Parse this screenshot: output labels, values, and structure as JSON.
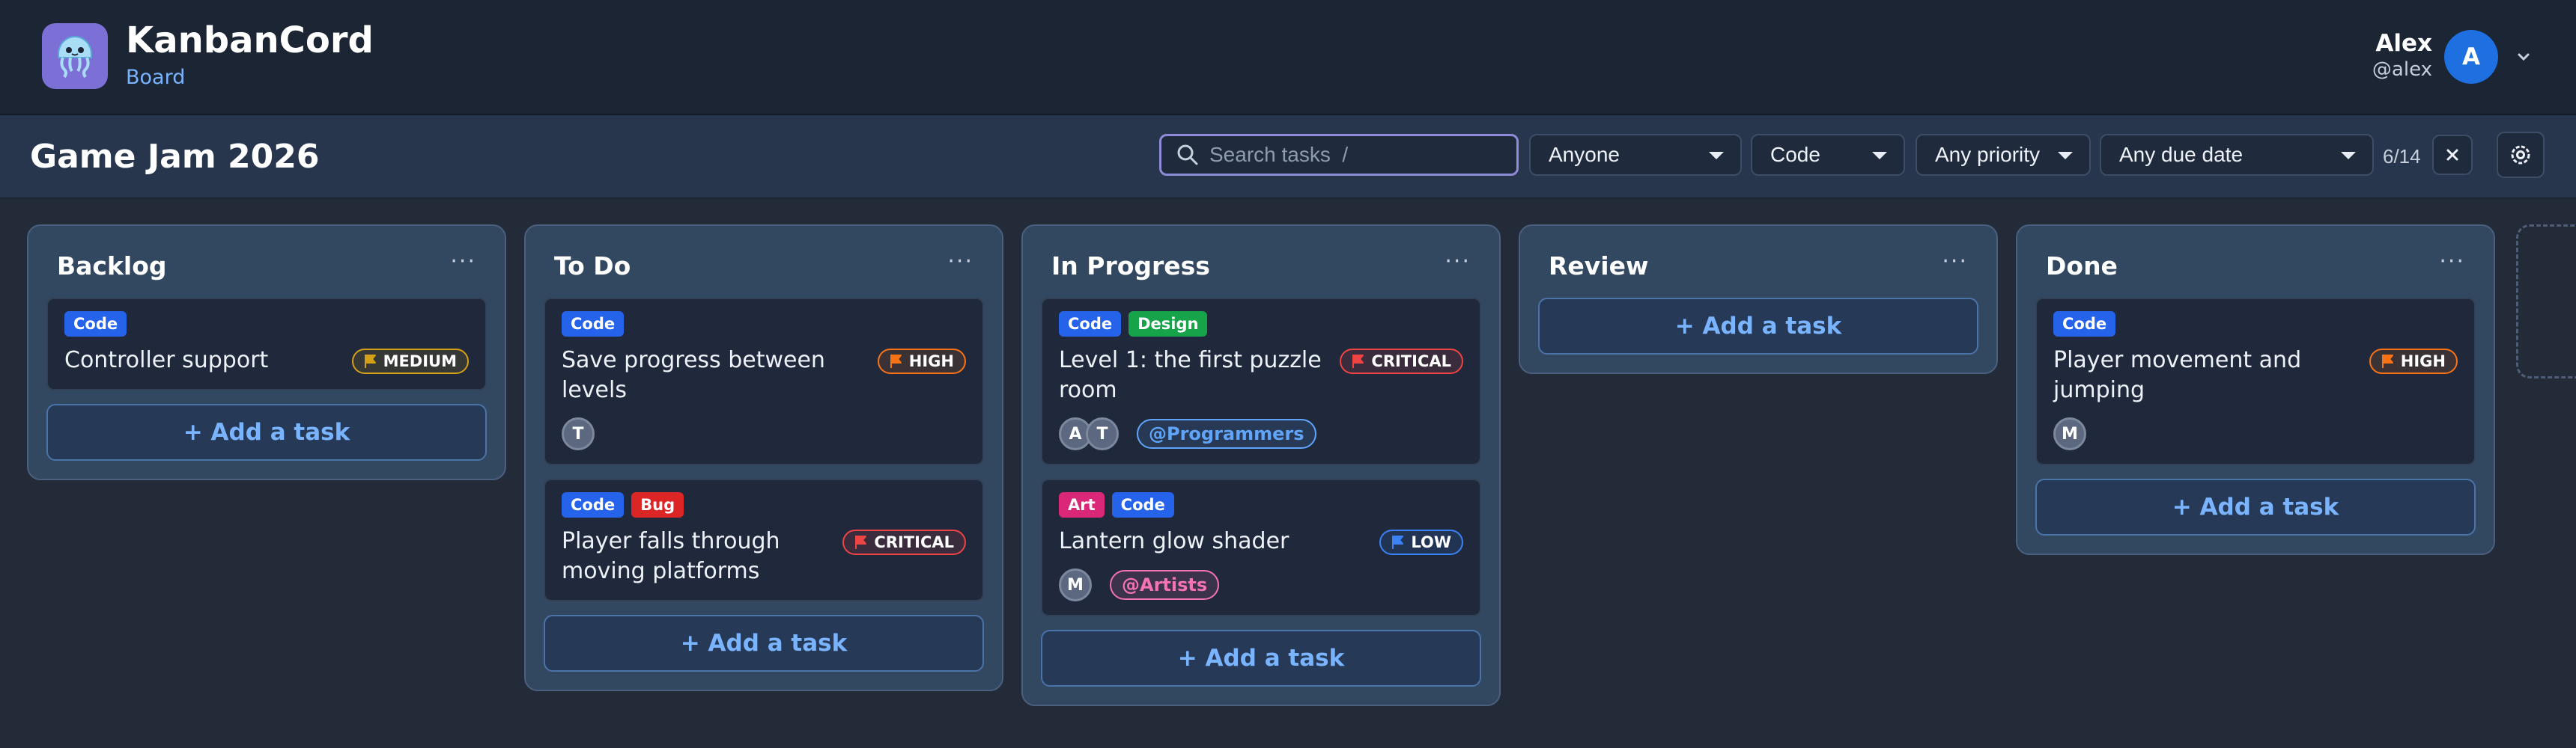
{
  "app": {
    "title": "KanbanCord",
    "subtitle": "Board"
  },
  "user": {
    "name": "Alex",
    "handle": "@alex",
    "avatar_initial": "A"
  },
  "board": {
    "title": "Game Jam 2026"
  },
  "filters": {
    "search_placeholder": "Search tasks  /",
    "assignee": "Anyone",
    "label": "Code",
    "priority": "Any priority",
    "due": "Any due date",
    "count": "6/14"
  },
  "colors": {
    "Code": "#2563eb",
    "Design": "#16a34a",
    "Bug": "#dc2626",
    "Art": "#db2777",
    "MEDIUM": "#d4a017",
    "HIGH": "#f97316",
    "CRITICAL": "#ef4444",
    "LOW": "#3b82f6",
    "Programmers": "#60a5fa",
    "Artists": "#f472b6"
  },
  "add_task_label": "+ Add a task",
  "column_menu_label": "···",
  "columns": [
    {
      "title": "Backlog",
      "cards": [
        {
          "tags": [
            "Code"
          ],
          "title": "Controller support",
          "priority": "MEDIUM",
          "avatars": [],
          "group": ""
        }
      ]
    },
    {
      "title": "To Do",
      "cards": [
        {
          "tags": [
            "Code"
          ],
          "title": "Save progress between levels",
          "priority": "HIGH",
          "avatars": [
            "T"
          ],
          "group": ""
        },
        {
          "tags": [
            "Code",
            "Bug"
          ],
          "title": "Player falls through moving platforms",
          "priority": "CRITICAL",
          "avatars": [],
          "group": ""
        }
      ]
    },
    {
      "title": "In Progress",
      "cards": [
        {
          "tags": [
            "Code",
            "Design"
          ],
          "title": "Level 1: the first puzzle room",
          "priority": "CRITICAL",
          "avatars": [
            "A",
            "T"
          ],
          "group": "@Programmers"
        },
        {
          "tags": [
            "Art",
            "Code"
          ],
          "title": "Lantern glow shader",
          "priority": "LOW",
          "avatars": [
            "M"
          ],
          "group": "@Artists"
        }
      ]
    },
    {
      "title": "Review",
      "cards": []
    },
    {
      "title": "Done",
      "cards": [
        {
          "tags": [
            "Code"
          ],
          "title": "Player movement and jumping",
          "priority": "HIGH",
          "avatars": [
            "M"
          ],
          "group": ""
        }
      ]
    }
  ]
}
